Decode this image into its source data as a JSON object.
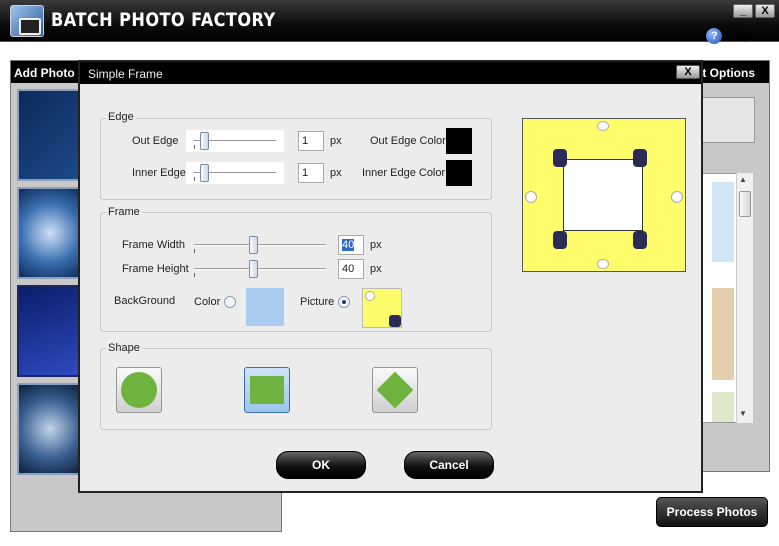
{
  "app": {
    "title": "BATCH PHOTO FACTORY",
    "help_label": "Help",
    "minimize_label": "_",
    "close_label": "X"
  },
  "left_panel": {
    "header": "Add Photo"
  },
  "right_panel": {
    "header": "t Options",
    "scroll_up": "▲",
    "scroll_down": "▼"
  },
  "process_button": "Process Photos",
  "dialog": {
    "title": "Simple Frame",
    "close_label": "X",
    "edge": {
      "label": "Edge",
      "out_edge_label": "Out Edge",
      "out_edge_value": "1",
      "out_edge_unit": "px",
      "out_edge_level": 0.08,
      "inner_edge_label": "Inner Edge",
      "inner_edge_value": "1",
      "inner_edge_unit": "px",
      "inner_edge_level": 0.08,
      "out_edge_color_label": "Out Edge Color",
      "out_edge_color": "#000000",
      "inner_edge_color_label": "Inner Edge Color",
      "inner_edge_color": "#000000"
    },
    "frame": {
      "label": "Frame",
      "width_label": "Frame Width",
      "width_value": "40",
      "width_unit": "px",
      "width_level": 0.45,
      "height_label": "Frame Height",
      "height_value": "40",
      "height_unit": "px",
      "height_level": 0.45,
      "background_label": "BackGround",
      "color_option": "Color",
      "picture_option": "Picture",
      "background_color": "#a9ccf0",
      "selected_background": "Picture"
    },
    "shape": {
      "label": "Shape",
      "options": [
        "circle",
        "rectangle",
        "diamond"
      ],
      "selected": "rectangle",
      "fill_color": "#6db33f"
    },
    "ok_label": "OK",
    "cancel_label": "Cancel"
  }
}
